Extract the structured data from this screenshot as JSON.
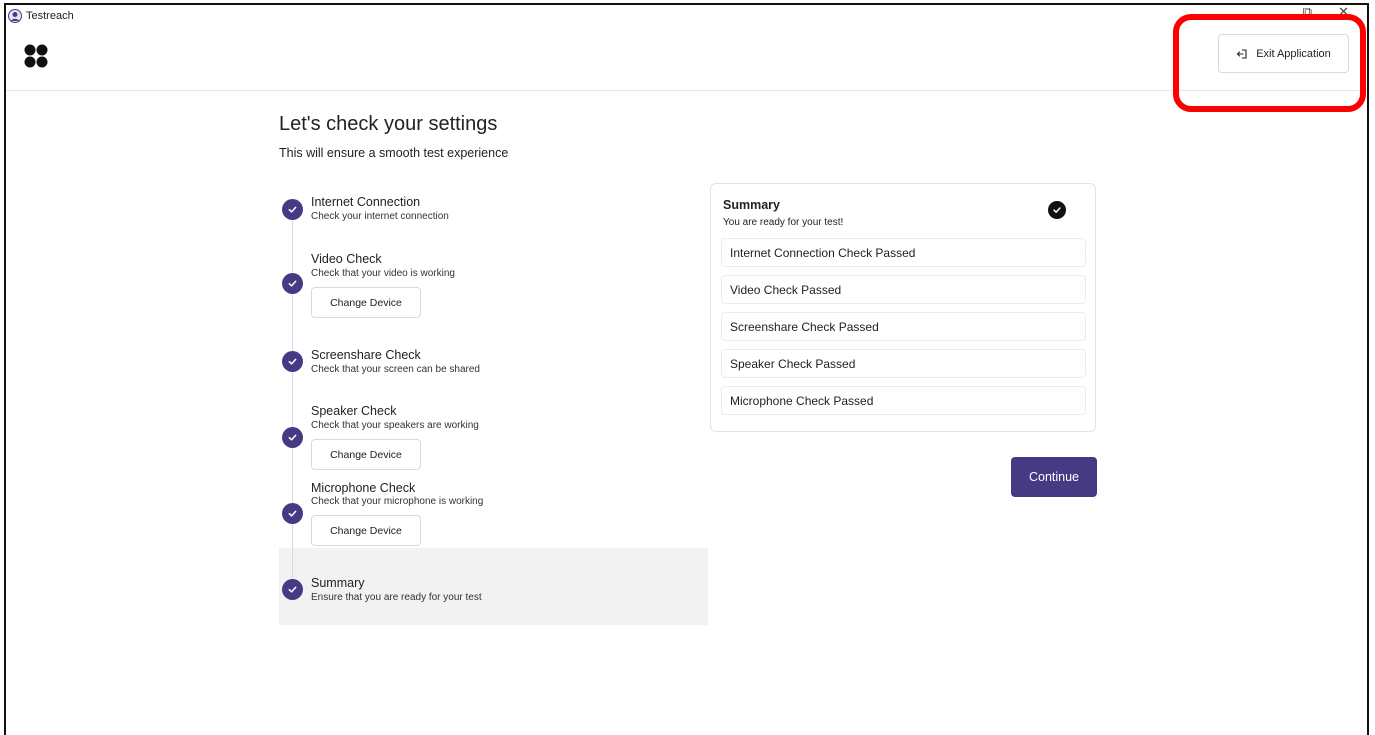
{
  "window": {
    "title": "Testreach",
    "controls": [
      "⧉",
      "✕"
    ]
  },
  "header": {
    "logo": "four-dot-logo",
    "exit_label": "Exit Application",
    "exit_icon": "exit-icon"
  },
  "page": {
    "title": "Let's check your settings",
    "subtitle": "This will ensure a smooth test experience"
  },
  "steps": [
    {
      "title": "Internet Connection",
      "desc": "Check your internet connection",
      "status": "done"
    },
    {
      "title": "Video Check",
      "desc": "Check that your video is working",
      "button": "Change Device",
      "status": "done"
    },
    {
      "title": "Screenshare Check",
      "desc": "Check that your screen can be shared",
      "status": "done"
    },
    {
      "title": "Speaker Check",
      "desc": "Check that your speakers are working",
      "button": "Change Device",
      "status": "done"
    },
    {
      "title": "Microphone Check",
      "desc": "Check that your microphone is working",
      "button": "Change Device",
      "status": "done"
    },
    {
      "title": "Summary",
      "desc": "Ensure that you are ready for your test",
      "status": "active"
    }
  ],
  "summary": {
    "title": "Summary",
    "subtitle": "You are ready for your test!",
    "results": [
      "Internet Connection Check Passed",
      "Video Check Passed",
      "Screenshare Check Passed",
      "Speaker Check Passed",
      "Microphone Check Passed"
    ]
  },
  "continue_label": "Continue",
  "colors": {
    "accent": "#463a84",
    "highlight": "#ff0000",
    "active_step_bg": "#f2f2f2"
  }
}
